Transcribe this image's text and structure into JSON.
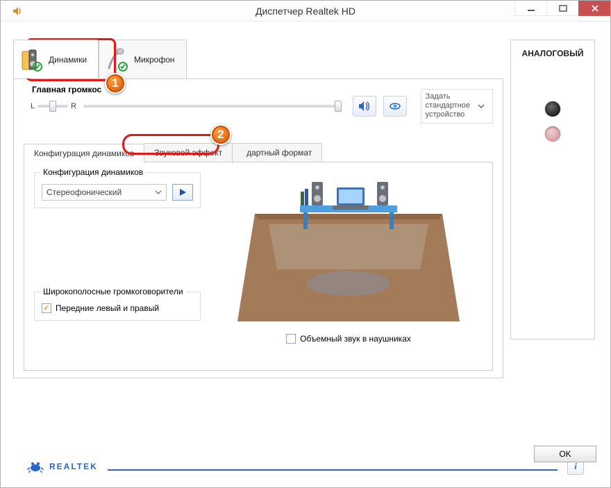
{
  "window": {
    "title": "Диспетчер Realtek HD"
  },
  "device_tabs": {
    "speakers": "Динамики",
    "microphone": "Микрофон"
  },
  "main_volume": {
    "legend": "Главная громкос",
    "left": "L",
    "right": "R"
  },
  "default_device": {
    "line1": "Задать",
    "line2": "стандартное",
    "line3": "устройство"
  },
  "sub_tabs": {
    "config": "Конфигурация динамиков",
    "effects": "Звуковой эффект",
    "format_partial": "дартный формат"
  },
  "speaker_config": {
    "legend": "Конфигурация динамиков",
    "selected": "Стереофонический"
  },
  "wideband": {
    "legend": "Широкополосные громкоговорители",
    "front_lr": "Передние левый и правый"
  },
  "surround_headphones": "Объемный звук в наушниках",
  "analog": {
    "title": "АНАЛОГОВЫЙ"
  },
  "brand": "REALTEK",
  "ok": "OK",
  "callouts": {
    "1": "1",
    "2": "2"
  }
}
